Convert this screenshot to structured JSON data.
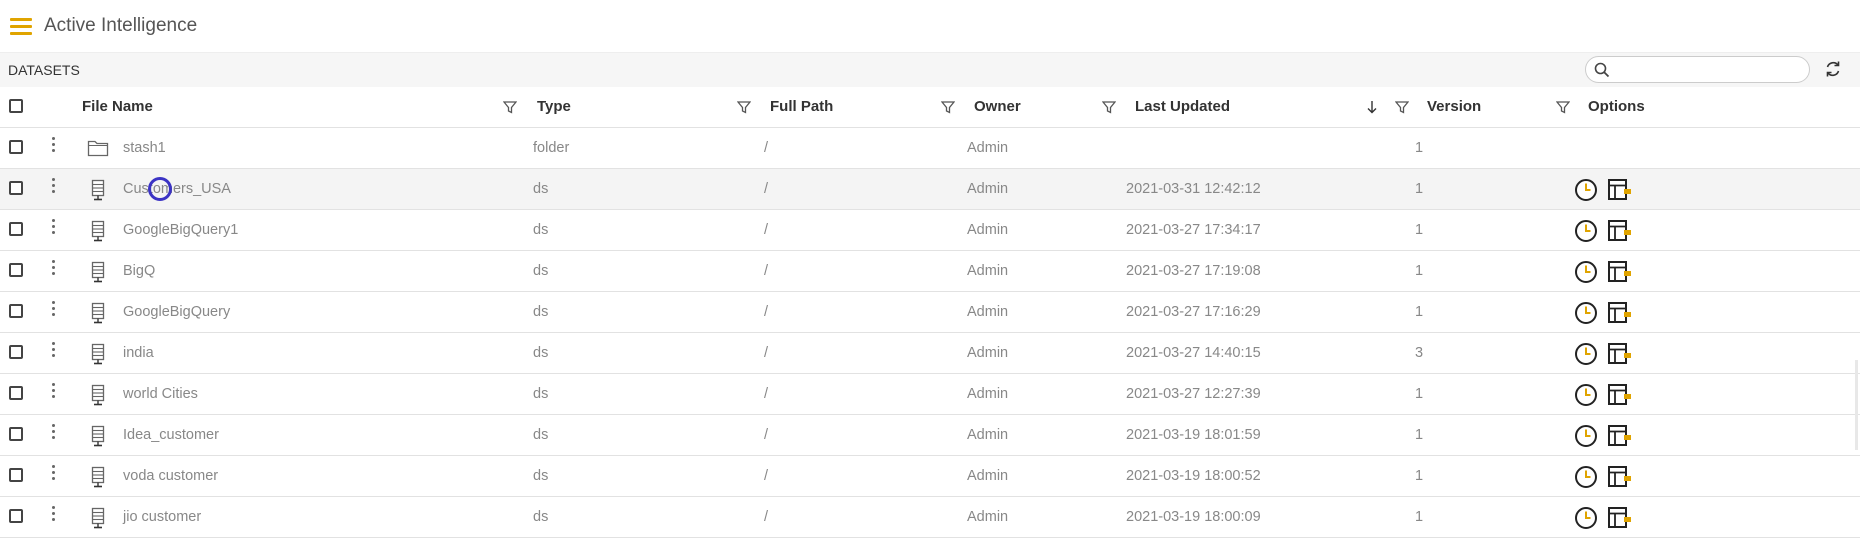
{
  "app": {
    "title": "Active Intelligence"
  },
  "toolbar": {
    "section_title": "DATASETS",
    "search_placeholder": ""
  },
  "columns": {
    "file_name": "File Name",
    "type": "Type",
    "full_path": "Full Path",
    "owner": "Owner",
    "last_updated": "Last Updated",
    "version": "Version",
    "options": "Options"
  },
  "rows": [
    {
      "name": "stash1",
      "type": "folder",
      "path": "/",
      "owner": "Admin",
      "updated": "",
      "version": "1",
      "icon": "folder-icon",
      "has_options": false
    },
    {
      "name": "Customers_USA",
      "type": "ds",
      "path": "/",
      "owner": "Admin",
      "updated": "2021-03-31 12:42:12",
      "version": "1",
      "icon": "dataset-icon",
      "has_options": true
    },
    {
      "name": "GoogleBigQuery1",
      "type": "ds",
      "path": "/",
      "owner": "Admin",
      "updated": "2021-03-27 17:34:17",
      "version": "1",
      "icon": "dataset-icon",
      "has_options": true
    },
    {
      "name": "BigQ",
      "type": "ds",
      "path": "/",
      "owner": "Admin",
      "updated": "2021-03-27 17:19:08",
      "version": "1",
      "icon": "dataset-icon",
      "has_options": true
    },
    {
      "name": "GoogleBigQuery",
      "type": "ds",
      "path": "/",
      "owner": "Admin",
      "updated": "2021-03-27 17:16:29",
      "version": "1",
      "icon": "dataset-icon",
      "has_options": true
    },
    {
      "name": "india",
      "type": "ds",
      "path": "/",
      "owner": "Admin",
      "updated": "2021-03-27 14:40:15",
      "version": "3",
      "icon": "dataset-icon",
      "has_options": true
    },
    {
      "name": "world Cities",
      "type": "ds",
      "path": "/",
      "owner": "Admin",
      "updated": "2021-03-27 12:27:39",
      "version": "1",
      "icon": "dataset-icon",
      "has_options": true
    },
    {
      "name": "Idea_customer",
      "type": "ds",
      "path": "/",
      "owner": "Admin",
      "updated": "2021-03-19 18:01:59",
      "version": "1",
      "icon": "dataset-icon",
      "has_options": true
    },
    {
      "name": "voda customer",
      "type": "ds",
      "path": "/",
      "owner": "Admin",
      "updated": "2021-03-19 18:00:52",
      "version": "1",
      "icon": "dataset-icon",
      "has_options": true
    },
    {
      "name": "jio customer",
      "type": "ds",
      "path": "/",
      "owner": "Admin",
      "updated": "2021-03-19 18:00:09",
      "version": "1",
      "icon": "dataset-icon",
      "has_options": true
    }
  ],
  "colors": {
    "accent": "#e0a400",
    "cursor": "#3b33c4"
  }
}
